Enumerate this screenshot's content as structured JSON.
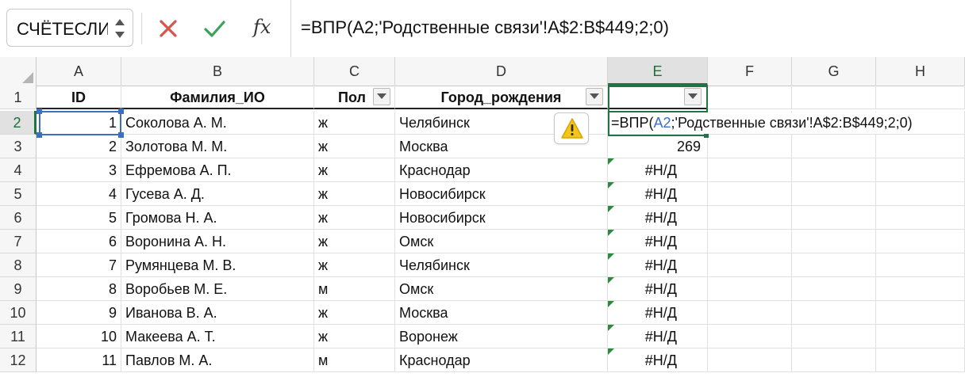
{
  "formula_bar": {
    "name_box": "СЧЁТЕСЛИ",
    "fx_label": "fx",
    "formula": "=ВПР(A2;'Родственные связи'!A$2:B$449;2;0)"
  },
  "columns": [
    "A",
    "B",
    "C",
    "D",
    "E",
    "F",
    "G",
    "H"
  ],
  "active_column": "E",
  "header_row": {
    "A": "ID",
    "B": "Фамилия_ИО",
    "C": "Пол",
    "D": "Город_рождения",
    "E": ""
  },
  "rows": [
    {
      "num": "2",
      "id": "1",
      "name": "Соколова А. М.",
      "sex": "ж",
      "city": "Челябинск",
      "e": ""
    },
    {
      "num": "3",
      "id": "2",
      "name": "Золотова М. М.",
      "sex": "ж",
      "city": "Москва",
      "e": "269"
    },
    {
      "num": "4",
      "id": "3",
      "name": "Ефремова А. П.",
      "sex": "ж",
      "city": "Краснодар",
      "e": "#Н/Д"
    },
    {
      "num": "5",
      "id": "4",
      "name": "Гусева А. Д.",
      "sex": "ж",
      "city": "Новосибирск",
      "e": "#Н/Д"
    },
    {
      "num": "6",
      "id": "5",
      "name": "Громова Н. А.",
      "sex": "ж",
      "city": "Новосибирск",
      "e": "#Н/Д"
    },
    {
      "num": "7",
      "id": "6",
      "name": "Воронина А. Н.",
      "sex": "ж",
      "city": "Омск",
      "e": "#Н/Д"
    },
    {
      "num": "8",
      "id": "7",
      "name": "Румянцева М. В.",
      "sex": "ж",
      "city": "Челябинск",
      "e": "#Н/Д"
    },
    {
      "num": "9",
      "id": "8",
      "name": "Воробьев М. Е.",
      "sex": "м",
      "city": "Омск",
      "e": "#Н/Д"
    },
    {
      "num": "10",
      "id": "9",
      "name": "Иванова В. А.",
      "sex": "ж",
      "city": "Москва",
      "e": "#Н/Д"
    },
    {
      "num": "11",
      "id": "10",
      "name": "Макеева А. Т.",
      "sex": "ж",
      "city": "Воронеж",
      "e": "#Н/Д"
    },
    {
      "num": "12",
      "id": "11",
      "name": "Павлов М. А.",
      "sex": "м",
      "city": "Краснодар",
      "e": "#Н/Д"
    }
  ],
  "row_numbers_header": "1",
  "edit_cell": {
    "prefix": "=ВПР(",
    "ref": "A2",
    "suffix": ";'Родственные связи'!A$2:B$449;2;0)"
  },
  "colors": {
    "excel_green": "#217346",
    "ref_blue": "#3b6fc4",
    "cancel_red": "#d9534f",
    "confirm_green": "#3aa35a",
    "warning_yellow": "#f5c518"
  },
  "icons": [
    "stepper-icon",
    "cancel-icon",
    "confirm-icon",
    "fx-icon",
    "filter-dropdown-icon",
    "warning-icon",
    "select-all-icon"
  ]
}
